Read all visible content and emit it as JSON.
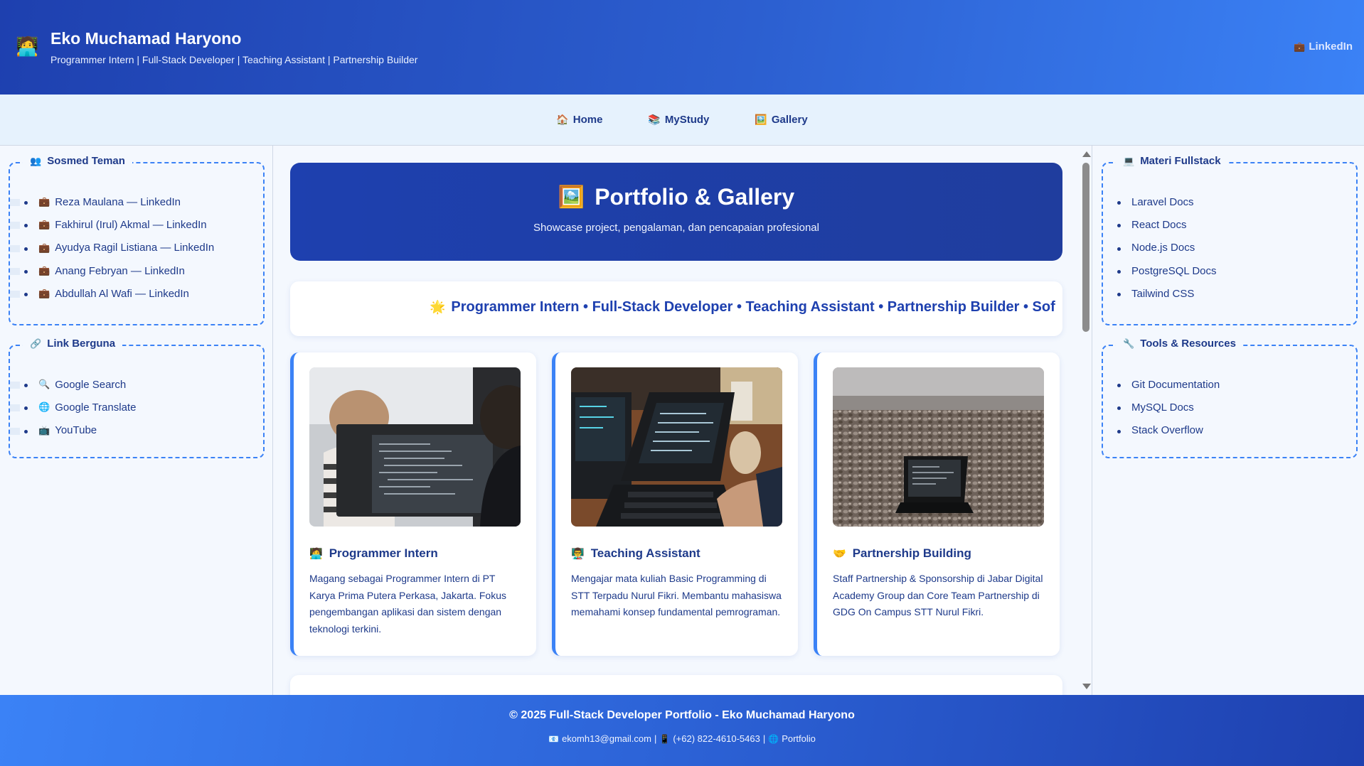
{
  "header": {
    "name": "Eko Muchamad Haryono",
    "tagline": "Programmer Intern | Full-Stack Developer | Teaching Assistant | Partnership Builder",
    "avatar_icon": "technologist-icon",
    "link_label": "LinkedIn",
    "link_icon": "briefcase-icon"
  },
  "nav": {
    "items": [
      {
        "label": "Home",
        "icon": "house-icon"
      },
      {
        "label": "MyStudy",
        "icon": "books-icon"
      },
      {
        "label": "Gallery",
        "icon": "picture-icon"
      }
    ]
  },
  "left_sidebar": {
    "friends": {
      "title": "Sosmed Teman",
      "icon": "people-icon",
      "items": [
        {
          "label": "Reza Maulana — LinkedIn",
          "icon": "briefcase-icon"
        },
        {
          "label": "Fakhirul (Irul) Akmal — LinkedIn",
          "icon": "briefcase-icon"
        },
        {
          "label": "Ayudya Ragil Listiana — LinkedIn",
          "icon": "briefcase-icon"
        },
        {
          "label": "Anang Febryan — LinkedIn",
          "icon": "briefcase-icon"
        },
        {
          "label": "Abdullah Al Wafi — LinkedIn",
          "icon": "briefcase-icon"
        }
      ]
    },
    "links": {
      "title": "Link Berguna",
      "icon": "link-icon",
      "items": [
        {
          "label": "Google Search",
          "icon": "magnifier-icon"
        },
        {
          "label": "Google Translate",
          "icon": "globe-icon"
        },
        {
          "label": "YouTube",
          "icon": "tv-icon"
        }
      ]
    }
  },
  "right_sidebar": {
    "fullstack": {
      "title": "Materi Fullstack",
      "icon": "computer-icon",
      "items": [
        "Laravel Docs",
        "React Docs",
        "Node.js Docs",
        "PostgreSQL Docs",
        "Tailwind CSS"
      ]
    },
    "tools": {
      "title": "Tools & Resources",
      "icon": "wrench-icon",
      "items": [
        "Git Documentation",
        "MySQL Docs",
        "Stack Overflow"
      ]
    }
  },
  "hero": {
    "title": "Portfolio & Gallery",
    "icon": "picture-icon",
    "subtitle": "Showcase project, pengalaman, dan pencapaian profesional"
  },
  "ticker": {
    "icon": "sparkle-icon",
    "text": "Programmer Intern • Full-Stack Developer • Teaching Assistant • Partnership Builder • Sof"
  },
  "cards": [
    {
      "title": "Programmer Intern",
      "icon": "technologist-icon",
      "description": "Magang sebagai Programmer Intern di PT Karya Prima Putera Perkasa, Jakarta. Fokus pengembangan aplikasi dan sistem dengan teknologi terkini."
    },
    {
      "title": "Teaching Assistant",
      "icon": "teacher-icon",
      "description": "Mengajar mata kuliah Basic Programming di STT Terpadu Nurul Fikri. Membantu mahasiswa memahami konsep fundamental pemrograman."
    },
    {
      "title": "Partnership Building",
      "icon": "handshake-icon",
      "description": "Staff Partnership & Sponsorship di Jabar Digital Academy Group dan Core Team Partnership di GDG On Campus STT Nurul Fikri."
    }
  ],
  "footer": {
    "title": "© 2025 Full-Stack Developer Portfolio - Eko Muchamad Haryono",
    "email": "ekomh13@gmail.com",
    "phone": "(+62) 822-4610-5463",
    "portfolio": "Portfolio",
    "separator": "|"
  },
  "colors": {
    "primary": "#1e40af",
    "accent": "#3b82f6",
    "text": "#1e3a8a",
    "background": "#f4f8fe",
    "nav_bg": "#e6f2fd"
  }
}
